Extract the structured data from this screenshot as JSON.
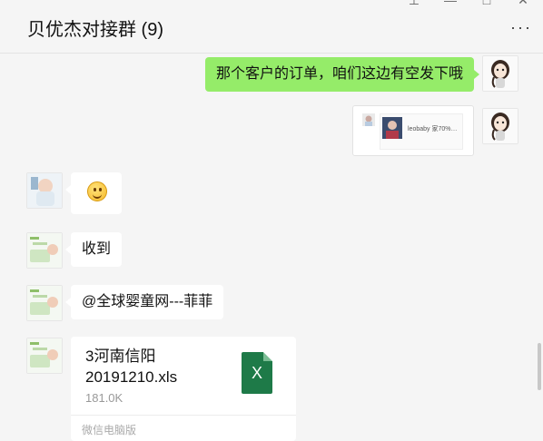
{
  "header": {
    "title": "贝优杰对接群 (9)",
    "window_controls": [
      "pin-icon",
      "minimize-icon",
      "maximize-icon",
      "close-icon"
    ],
    "more_icon": "more-icon"
  },
  "messages": {
    "m1": {
      "side": "right",
      "text": "那个客户的订单，咱们这边有空发下哦"
    },
    "m2": {
      "side": "right",
      "type": "screenshot-card",
      "tiny_text": "leobaby 家70%…"
    },
    "m3": {
      "side": "left",
      "type": "emoji",
      "emoji": "smile"
    },
    "m4": {
      "side": "left",
      "text": "收到"
    },
    "m5": {
      "side": "left",
      "text": "@全球婴童网---菲菲"
    },
    "m6": {
      "side": "left",
      "type": "file",
      "file_name": "3河南信阳20191210.xls",
      "file_size": "181.0K",
      "source": "微信电脑版",
      "icon": "xls-file-icon"
    }
  },
  "colors": {
    "self_bubble": "#95ec69",
    "other_bubble": "#ffffff",
    "background": "#f5f5f5",
    "xls": "#1e7a48"
  }
}
